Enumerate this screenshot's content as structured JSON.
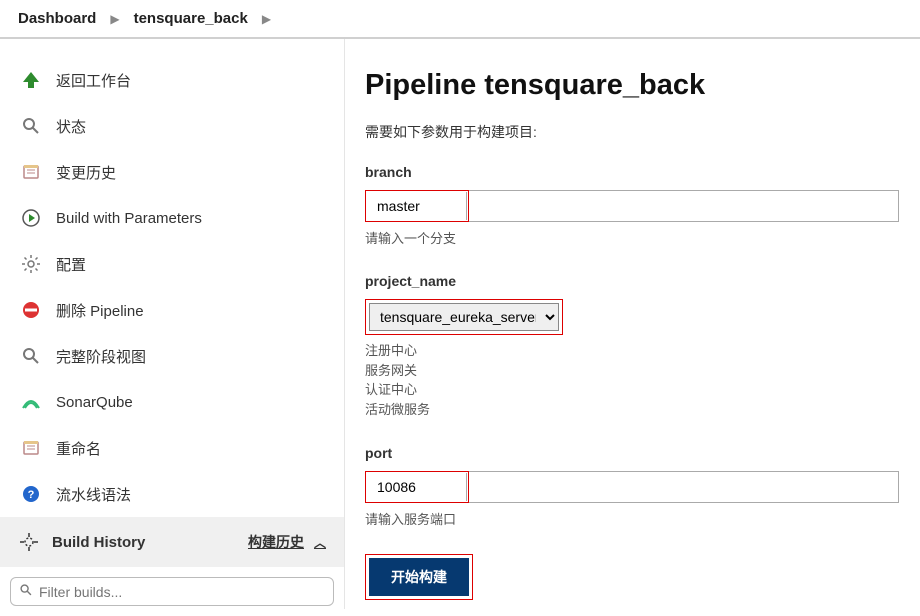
{
  "breadcrumb": [
    {
      "label": "Dashboard"
    },
    {
      "label": "tensquare_back"
    }
  ],
  "sidebar": {
    "items": [
      {
        "label": "返回工作台",
        "icon": "up-arrow"
      },
      {
        "label": "状态",
        "icon": "search"
      },
      {
        "label": "变更历史",
        "icon": "notes"
      },
      {
        "label": "Build with Parameters",
        "icon": "clock-play"
      },
      {
        "label": "配置",
        "icon": "gear"
      },
      {
        "label": "删除 Pipeline",
        "icon": "no-entry"
      },
      {
        "label": "完整阶段视图",
        "icon": "search"
      },
      {
        "label": "SonarQube",
        "icon": "wave"
      },
      {
        "label": "重命名",
        "icon": "notes"
      },
      {
        "label": "流水线语法",
        "icon": "help-blue"
      }
    ]
  },
  "buildHistory": {
    "title": "Build History",
    "link": "构建历史"
  },
  "filter": {
    "placeholder": "Filter builds..."
  },
  "main": {
    "title": "Pipeline tensquare_back",
    "desc": "需要如下参数用于构建项目:",
    "params": {
      "branch": {
        "label": "branch",
        "value": "master",
        "help": "请输入一个分支"
      },
      "project_name": {
        "label": "project_name",
        "selected": "tensquare_eureka_server",
        "options": [
          "注册中心",
          "服务网关",
          "认证中心",
          "活动微服务"
        ]
      },
      "port": {
        "label": "port",
        "value": "10086",
        "help": "请输入服务端口"
      }
    },
    "submit": "开始构建"
  }
}
